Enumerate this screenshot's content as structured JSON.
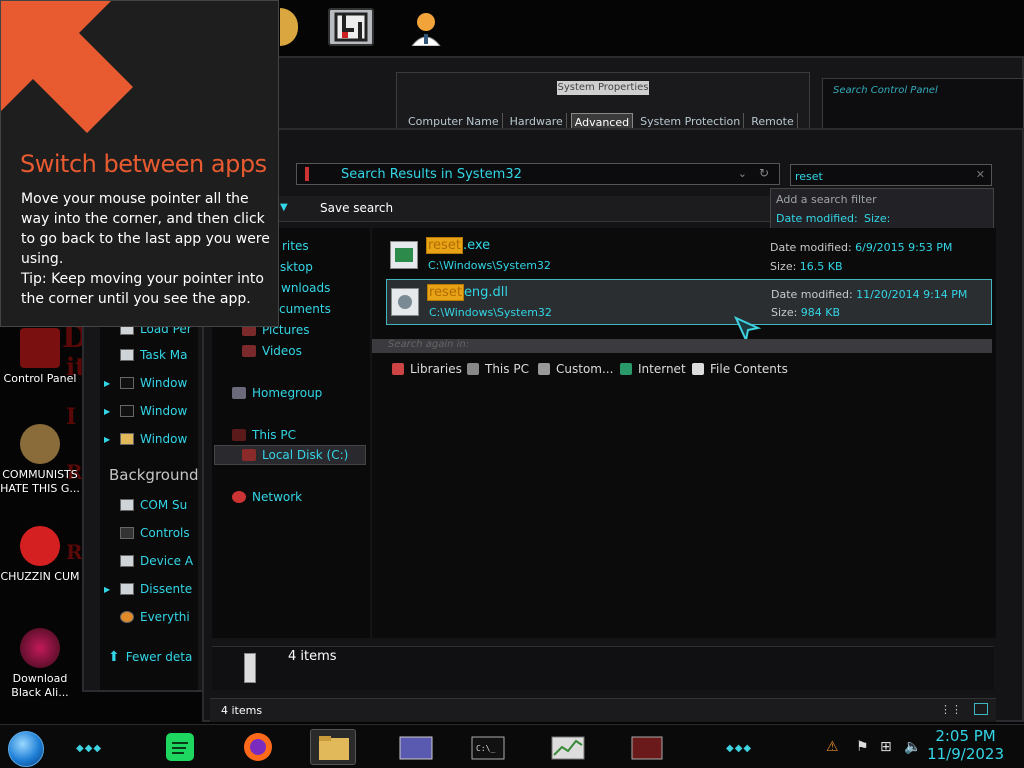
{
  "tip": {
    "title": "Switch between apps",
    "body": "Move your mouse pointer all the way into the corner, and then click to go back to the last app you were using.",
    "tip_text": "Tip: Keep moving your pointer into the corner until you see the app.",
    "accent": "#e85a30"
  },
  "desktop_icons": [
    {
      "label": "Control Panel"
    },
    {
      "label": "COMMUNISTS HATE THIS G..."
    },
    {
      "label": "CHUZZIN CUM"
    },
    {
      "label": "Download Black Ali..."
    }
  ],
  "system_properties": {
    "title": "System Properties",
    "tabs": [
      "Computer Name",
      "Hardware",
      "Advanced",
      "System Protection",
      "Remote"
    ],
    "active_tab": "Advanced"
  },
  "control_panel": {
    "search_placeholder": "Search Control Panel",
    "items": [
      {
        "label": "Load Per",
        "icon": "app-icon"
      },
      {
        "label": "Task Ma",
        "icon": "task-manager-icon"
      },
      {
        "label": "Window",
        "icon": "cmd-icon"
      },
      {
        "label": "Window",
        "icon": "cmd-icon"
      },
      {
        "label": "Window",
        "icon": "folder-icon"
      },
      {
        "label": "COM Su",
        "icon": "app-icon"
      },
      {
        "label": "Controls",
        "icon": "app-icon"
      },
      {
        "label": "Device A",
        "icon": "app-icon"
      },
      {
        "label": "Dissente",
        "icon": "app-icon"
      },
      {
        "label": "Everythi",
        "icon": "search-icon"
      }
    ],
    "background_header": "Background",
    "fewer_details": "Fewer deta"
  },
  "explorer": {
    "address": "Search Results in System32",
    "search_value": "reset",
    "filter_popup": {
      "header": "Add a search filter",
      "options": [
        "Date modified:",
        "Size:"
      ]
    },
    "toolbar": {
      "save_search": "Save search"
    },
    "nav": {
      "favorites_partial": "rites",
      "desktop_partial": "sktop",
      "downloads_partial": "wnloads",
      "documents_partial": "cuments",
      "pictures": "Pictures",
      "videos": "Videos",
      "homegroup": "Homegroup",
      "this_pc": "This PC",
      "local_disk": "Local Disk (C:)",
      "network": "Network"
    },
    "results": [
      {
        "name_highlight": "reset",
        "name_rest": ".exe",
        "path": "C:\\Windows\\System32",
        "date_label": "Date modified:",
        "date": "6/9/2015 9:53 PM",
        "size_label": "Size:",
        "size": "16.5 KB",
        "selected": false
      },
      {
        "name_highlight": "reset",
        "name_rest": "eng.dll",
        "path": "C:\\Windows\\System32",
        "date_label": "Date modified:",
        "date": "11/20/2014 9:14 PM",
        "size_label": "Size:",
        "size": "984 KB",
        "selected": true
      }
    ],
    "search_again": {
      "header": "Search again in:",
      "locations": [
        "Libraries",
        "This PC",
        "Custom...",
        "Internet",
        "File Contents"
      ]
    },
    "details_count": "4 items",
    "status_count": "4 items"
  },
  "taskbar": {
    "time": "2:05 PM",
    "date": "11/9/2023"
  },
  "colors": {
    "accent_cyan": "#33d6e6",
    "highlight": "#e8a317",
    "selection_border": "#3fb6c0"
  }
}
